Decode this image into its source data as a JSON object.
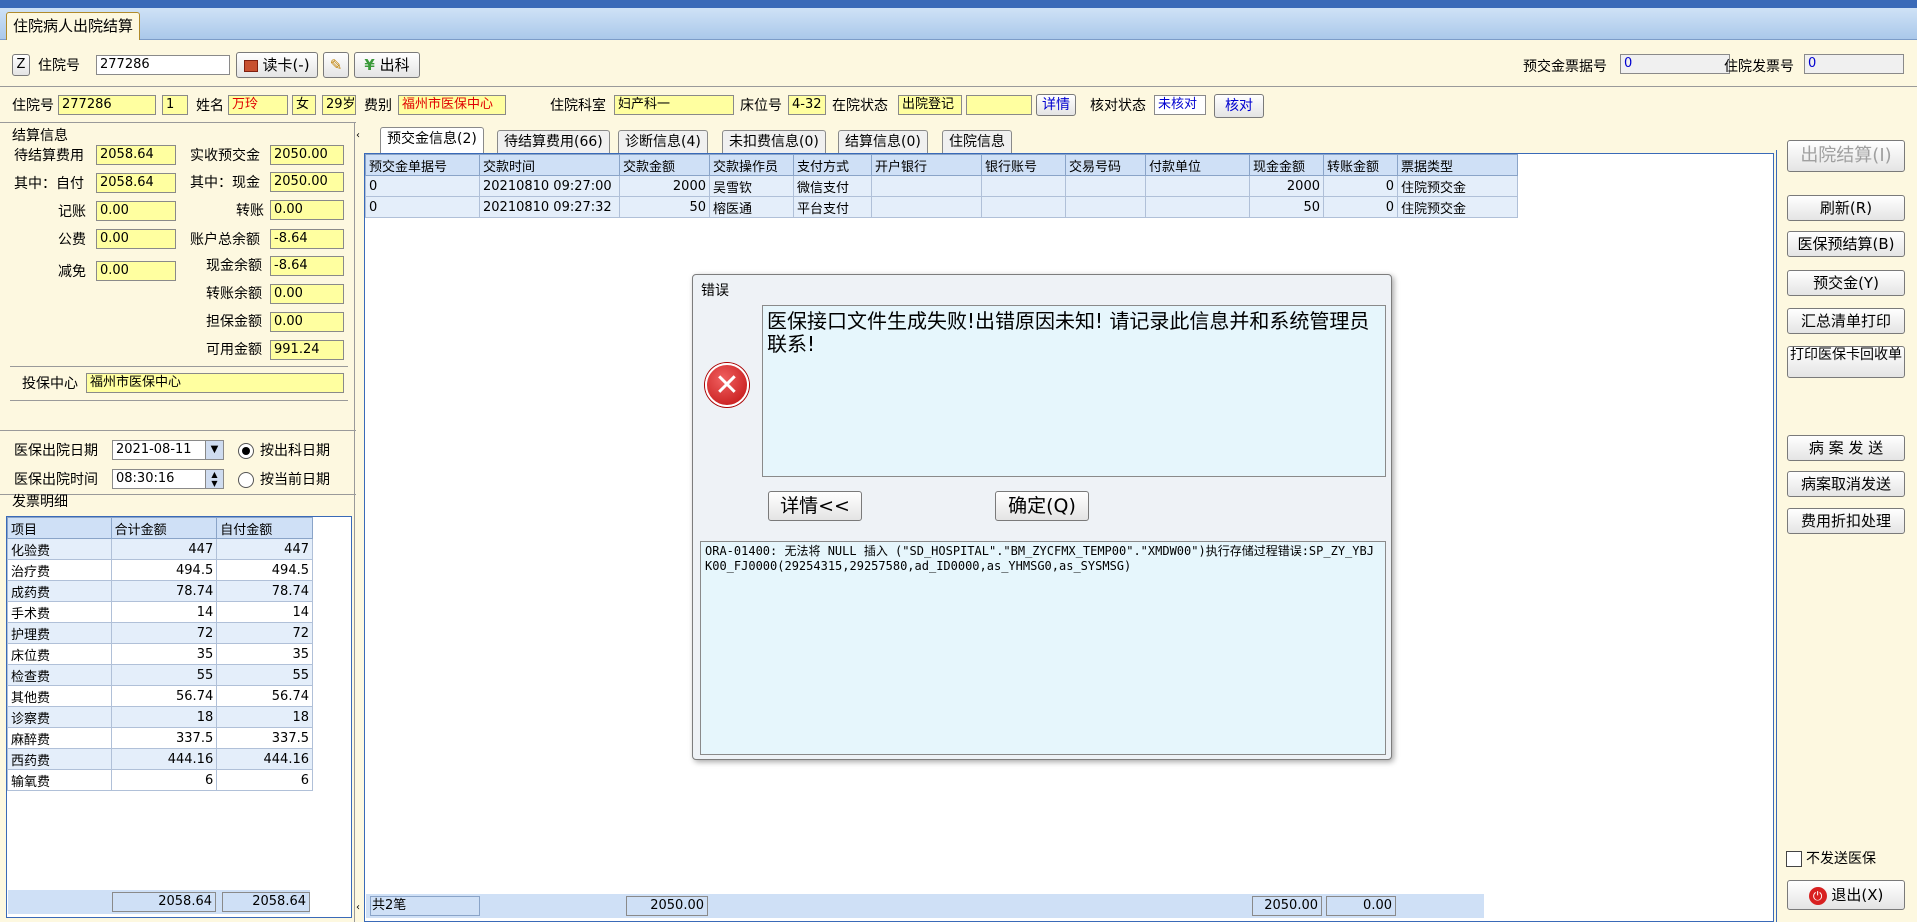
{
  "tabs": {
    "main": "住院病人出院结算"
  },
  "toolbar": {
    "z_label": "Z",
    "inpatient_no_label": "住院号",
    "inpatient_no_value": "277286",
    "read_card": "读卡(-)",
    "discharge": "出科",
    "deposit_receipt_label": "预交金票据号",
    "deposit_receipt_value": "0",
    "invoice_label": "住院发票号",
    "invoice_value": "0"
  },
  "patient": {
    "no_label": "住院号",
    "no_value": "277286",
    "seq": "1",
    "name_label": "姓名",
    "name_value": "万玲",
    "sex": "女",
    "age": "29岁",
    "fee_type_label": "费别",
    "fee_type_value": "福州市医保中心",
    "dept_label": "住院科室",
    "dept_value": "妇产科一",
    "bed_label": "床位号",
    "bed_value": "4-32",
    "status_label": "在院状态",
    "status_value": "出院登记",
    "detail": "详情",
    "check_label": "核对状态",
    "check_value": "未核对",
    "check_button": "核对"
  },
  "settle": {
    "title": "结算信息",
    "pending_label": "待结算费用",
    "pending_value": "2058.64",
    "self_label": "其中：自付",
    "self_value": "2058.64",
    "account_label": "记账",
    "account_value": "0.00",
    "public_label": "公费",
    "public_value": "0.00",
    "relief_label": "减免",
    "relief_value": "0.00",
    "received_label": "实收预交金",
    "received_value": "2050.00",
    "cash_label": "其中：现金",
    "cash_value": "2050.00",
    "transfer_label": "转账",
    "transfer_value": "0.00",
    "total_balance_label": "账户总余额",
    "total_balance_value": "-8.64",
    "cash_balance_label": "现金余额",
    "cash_balance_value": "-8.64",
    "transfer_balance_label": "转账余额",
    "transfer_balance_value": "0.00",
    "guarantee_label": "担保金额",
    "guarantee_value": "0.00",
    "available_label": "可用金额",
    "available_value": "991.24",
    "insurer_label": "投保中心",
    "insurer_value": "福州市医保中心"
  },
  "discharge": {
    "date_label": "医保出院日期",
    "date_value": "2021-08-11",
    "time_label": "医保出院时间",
    "time_value": "08:30:16",
    "radio1": "按出科日期",
    "radio2": "按当前日期"
  },
  "invoice": {
    "title": "发票明细",
    "headers": [
      "项目",
      "合计金额",
      "自付金额"
    ],
    "rows": [
      [
        "化验费",
        "447",
        "447"
      ],
      [
        "治疗费",
        "494.5",
        "494.5"
      ],
      [
        "成药费",
        "78.74",
        "78.74"
      ],
      [
        "手术费",
        "14",
        "14"
      ],
      [
        "护理费",
        "72",
        "72"
      ],
      [
        "床位费",
        "35",
        "35"
      ],
      [
        "检查费",
        "55",
        "55"
      ],
      [
        "其他费",
        "56.74",
        "56.74"
      ],
      [
        "诊察费",
        "18",
        "18"
      ],
      [
        "麻醉费",
        "337.5",
        "337.5"
      ],
      [
        "西药费",
        "444.16",
        "444.16"
      ],
      [
        "输氧费",
        "6",
        "6"
      ]
    ],
    "total": "2058.64",
    "self_total": "2058.64"
  },
  "subtabs": [
    "预交金信息(2)",
    "待结算费用(66)",
    "诊断信息(4)",
    "未扣费信息(0)",
    "结算信息(0)",
    "住院信息"
  ],
  "deposits": {
    "headers": [
      "预交金单据号",
      "交款时间",
      "交款金额",
      "交款操作员",
      "支付方式",
      "开户银行",
      "银行账号",
      "交易号码",
      "付款单位",
      "现金金额",
      "转账金额",
      "票据类型"
    ],
    "rows": [
      [
        "0",
        "20210810 09:27:00",
        "2000",
        "吴雪钦",
        "微信支付",
        "",
        "",
        "",
        "",
        "2000",
        "0",
        "住院预交金"
      ],
      [
        "0",
        "20210810 09:27:32",
        "50",
        "榕医通",
        "平台支付",
        "",
        "",
        "",
        "",
        "50",
        "0",
        "住院预交金"
      ]
    ],
    "footer_count": "共2笔",
    "footer_amount": "2050.00",
    "footer_cash": "2050.00",
    "footer_transfer": "0.00"
  },
  "dialog": {
    "title": "错误",
    "message": "医保接口文件生成失败!出错原因未知! 请记录此信息并和系统管理员联系!",
    "details_button": "详情<<",
    "ok_button": "确定(Q)",
    "details_text": "ORA-01400: 无法将 NULL 插入 (\"SD_HOSPITAL\".\"BM_ZYCFMX_TEMP00\".\"XMDW00\")执行存储过程错误:SP_ZY_YBJK00_FJ0000(29254315,29257580,ad_ID0000,as_YHMSG0,as_SYSMSG)"
  },
  "right_buttons": {
    "settle": "出院结算(I)",
    "refresh": "刷新(R)",
    "pre_settle": "医保预结算(B)",
    "deposit": "预交金(Y)",
    "print_summary": "汇总清单打印",
    "print_card": "打印医保卡回收单",
    "send_case": "病 案 发 送",
    "cancel_case": "病案取消发送",
    "discount": "费用折扣处理",
    "no_send_label": "不发送医保",
    "exit": "退出(X)"
  },
  "colors": {
    "accent": "#3a6ab8",
    "field": "#ffffa0",
    "error": "#d81e1e"
  }
}
